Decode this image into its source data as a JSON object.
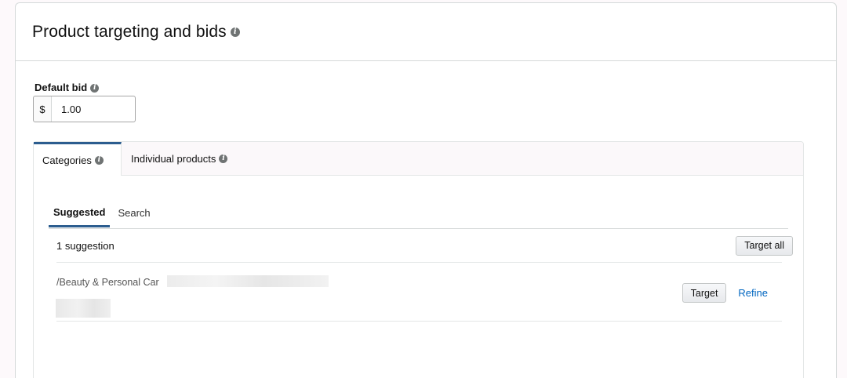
{
  "section": {
    "title": "Product targeting and bids"
  },
  "default_bid": {
    "label": "Default bid",
    "currency": "$",
    "value": "1.00"
  },
  "tabs": [
    {
      "label": "Categories",
      "active": true
    },
    {
      "label": "Individual products",
      "active": false
    }
  ],
  "subtabs": [
    {
      "label": "Suggested",
      "active": true
    },
    {
      "label": "Search",
      "active": false
    }
  ],
  "suggestions": {
    "count_text": "1 suggestion",
    "target_all_label": "Target all",
    "items": [
      {
        "path": "/Beauty & Personal Car",
        "target_label": "Target",
        "refine_label": "Refine"
      }
    ]
  },
  "colors": {
    "active_tab_accent": "#2c5d8f",
    "link": "#0066c0"
  }
}
